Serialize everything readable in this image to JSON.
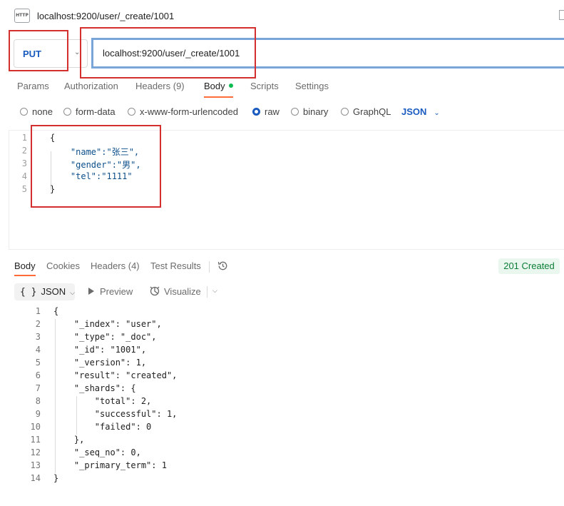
{
  "titlebar": {
    "icon_label": "HTTP",
    "title": "localhost:9200/user/_create/1001"
  },
  "request": {
    "method": "PUT",
    "url": "localhost:9200/user/_create/1001",
    "tabs": [
      {
        "label": "Params"
      },
      {
        "label": "Authorization"
      },
      {
        "label": "Headers (9)"
      },
      {
        "label": "Body",
        "active": true
      },
      {
        "label": "Scripts"
      },
      {
        "label": "Settings"
      }
    ],
    "body_options": [
      {
        "label": "none"
      },
      {
        "label": "form-data"
      },
      {
        "label": "x-www-form-urlencoded"
      },
      {
        "label": "raw",
        "selected": true
      },
      {
        "label": "binary"
      },
      {
        "label": "GraphQL"
      }
    ],
    "body_language": "JSON",
    "body_lines": [
      {
        "n": "1",
        "text": "{"
      },
      {
        "n": "2",
        "text": "    \"name\":\"张三\","
      },
      {
        "n": "3",
        "text": "    \"gender\":\"男\","
      },
      {
        "n": "4",
        "text": "    \"tel\":\"1111\""
      },
      {
        "n": "5",
        "text": "}"
      }
    ]
  },
  "response": {
    "tabs": [
      {
        "label": "Body",
        "active": true
      },
      {
        "label": "Cookies"
      },
      {
        "label": "Headers (4)"
      },
      {
        "label": "Test Results"
      }
    ],
    "status": "201 Created",
    "format": "JSON",
    "preview_label": "Preview",
    "visualize_label": "Visualize",
    "lines": [
      {
        "n": "1",
        "text": "{"
      },
      {
        "n": "2",
        "text": "    \"_index\": \"user\","
      },
      {
        "n": "3",
        "text": "    \"_type\": \"_doc\","
      },
      {
        "n": "4",
        "text": "    \"_id\": \"1001\","
      },
      {
        "n": "5",
        "text": "    \"_version\": 1,"
      },
      {
        "n": "6",
        "text": "    \"result\": \"created\","
      },
      {
        "n": "7",
        "text": "    \"_shards\": {"
      },
      {
        "n": "8",
        "text": "        \"total\": 2,"
      },
      {
        "n": "9",
        "text": "        \"successful\": 1,"
      },
      {
        "n": "10",
        "text": "        \"failed\": 0"
      },
      {
        "n": "11",
        "text": "    },"
      },
      {
        "n": "12",
        "text": "    \"_seq_no\": 0,"
      },
      {
        "n": "13",
        "text": "    \"_primary_term\": 1"
      },
      {
        "n": "14",
        "text": "}"
      }
    ]
  },
  "colors": {
    "accent": "#ff6c37",
    "method": "#1a5bbf",
    "status_bg": "#eaf7ee",
    "status_text": "#0a7d36",
    "annotation": "#d32f2f"
  }
}
